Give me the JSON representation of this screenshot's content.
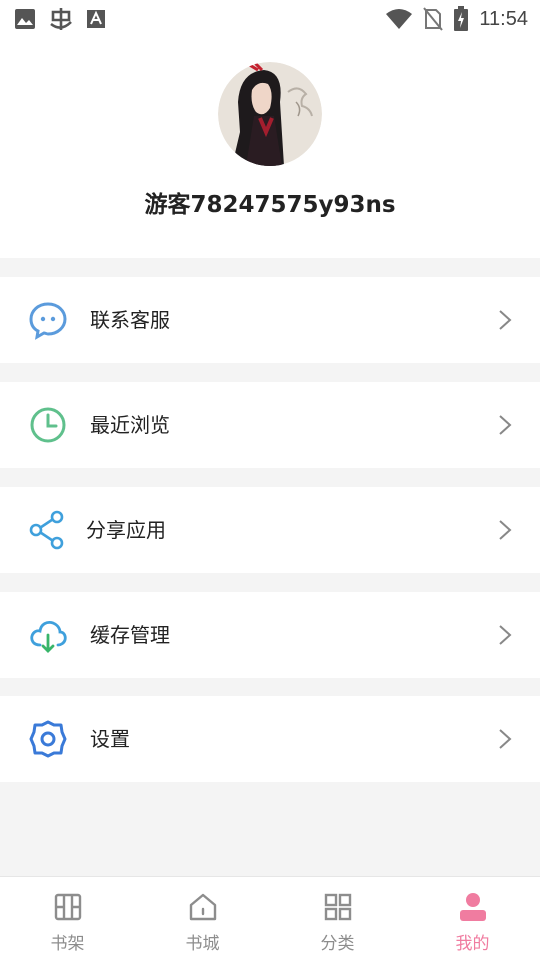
{
  "status_bar": {
    "time": "11:54",
    "left_icons": [
      "image-icon",
      "bug-icon",
      "font-icon"
    ],
    "right_icons": [
      "wifi-icon",
      "no-sim-icon",
      "battery-charging-icon"
    ]
  },
  "profile": {
    "username": "游客78247575y93ns"
  },
  "menu": {
    "items": [
      {
        "label": "联系客服",
        "icon": "chat-bubble-icon",
        "color": "#5b9bdc"
      },
      {
        "label": "最近浏览",
        "icon": "clock-icon",
        "color": "#5fc08c"
      },
      {
        "label": "分享应用",
        "icon": "share-icon",
        "color": "#3fa0dc"
      },
      {
        "label": "缓存管理",
        "icon": "cloud-download-icon",
        "color": "#3fa0dc"
      },
      {
        "label": "设置",
        "icon": "gear-icon",
        "color": "#3a7ad8"
      }
    ]
  },
  "tabbar": {
    "tabs": [
      {
        "label": "书架",
        "icon": "bookshelf-icon",
        "active": false
      },
      {
        "label": "书城",
        "icon": "home-icon",
        "active": false
      },
      {
        "label": "分类",
        "icon": "category-grid-icon",
        "active": false
      },
      {
        "label": "我的",
        "icon": "person-icon",
        "active": true
      }
    ],
    "active_color": "#f07ca0",
    "inactive_color": "#8d8d8d"
  }
}
